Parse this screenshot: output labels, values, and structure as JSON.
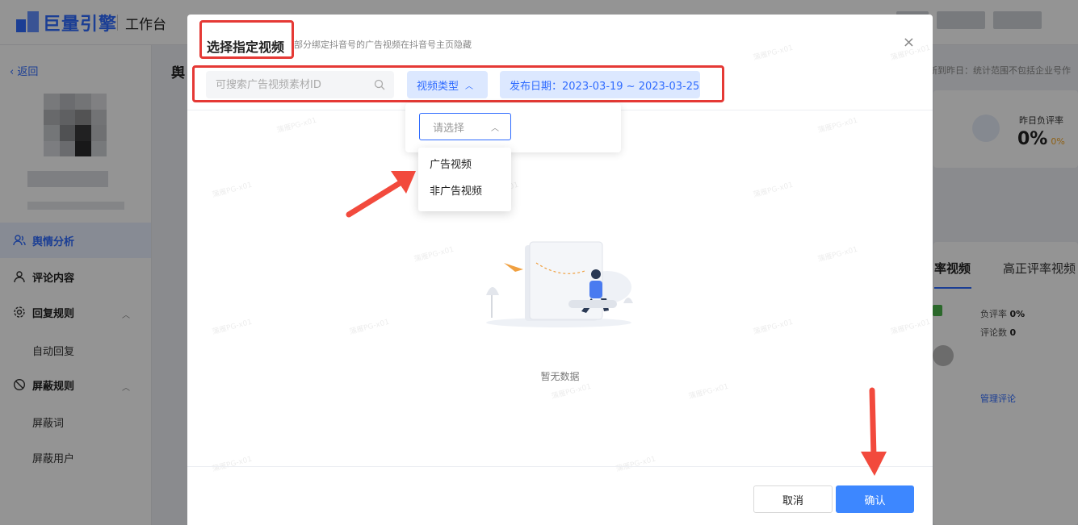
{
  "app": {
    "logo_text": "巨量引擎",
    "workbench_label": "工作台"
  },
  "sidebar": {
    "back_label": "返回",
    "items": [
      {
        "label": "舆情分析",
        "icon": "user-icon"
      },
      {
        "label": "评论内容",
        "icon": "person-icon"
      },
      {
        "label": "回复规则",
        "icon": "gear-icon"
      },
      {
        "label": "自动回复"
      },
      {
        "label": "屏蔽规则",
        "icon": "block-icon"
      },
      {
        "label": "屏蔽词"
      },
      {
        "label": "屏蔽用户"
      }
    ]
  },
  "background": {
    "page_title": "舆",
    "note": "新到昨日：统计范围不包括企业号作",
    "neg_rate_label": "昨日负评率",
    "neg_rate_value": "0%",
    "neg_rate_delta": "0%",
    "tab_active": "率视频",
    "tab_other": "高正评率视频",
    "stat_neg_label": "负评率",
    "stat_neg_value": "0%",
    "stat_comment_label": "评论数",
    "stat_comment_value": "0",
    "manage_link": "管理评论"
  },
  "modal": {
    "title": "选择指定视频",
    "description": "部分绑定抖音号的广告视频在抖音号主页隐藏",
    "close_label": "×",
    "search_placeholder": "可搜索广告视频素材ID",
    "video_type_label": "视频类型",
    "date_label": "发布日期：2023-03-19 ~ 2023-03-25",
    "select_placeholder": "请选择",
    "dropdown_options": [
      "广告视频",
      "非广告视频"
    ],
    "empty_text": "暂无数据",
    "cancel_label": "取消",
    "confirm_label": "确认",
    "watermark": "蒲雁PG-x01"
  },
  "colors": {
    "accent": "#2f6bff",
    "annotation_red": "#e53935"
  }
}
